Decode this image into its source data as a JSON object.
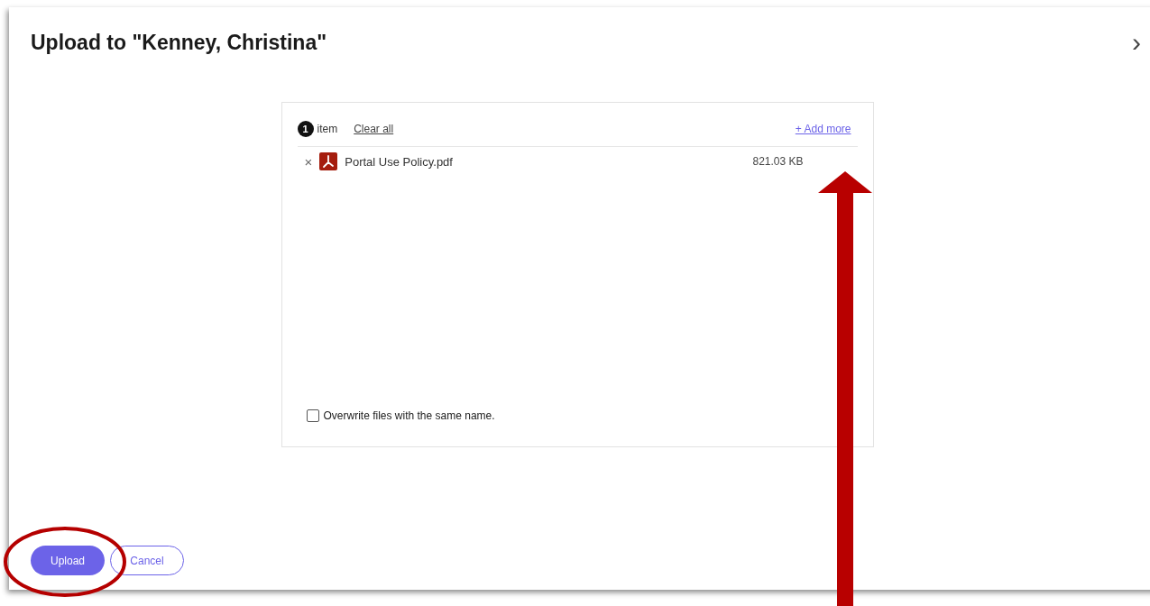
{
  "dialog": {
    "title": "Upload to \"Kenney, Christina\"",
    "collapse_icon": "›"
  },
  "upload_list": {
    "count": "1",
    "count_label": "item",
    "clear_all": "Clear all",
    "add_more": "+ Add more",
    "files": [
      {
        "remove": "×",
        "name": "Portal Use Policy.pdf",
        "size": "821.03 KB"
      }
    ],
    "overwrite": {
      "label": "Overwrite files with the same name.",
      "checked": false
    }
  },
  "buttons": [
    {
      "label": "Upload",
      "kind": "primary"
    },
    {
      "label": "Cancel",
      "kind": "secondary"
    }
  ]
}
